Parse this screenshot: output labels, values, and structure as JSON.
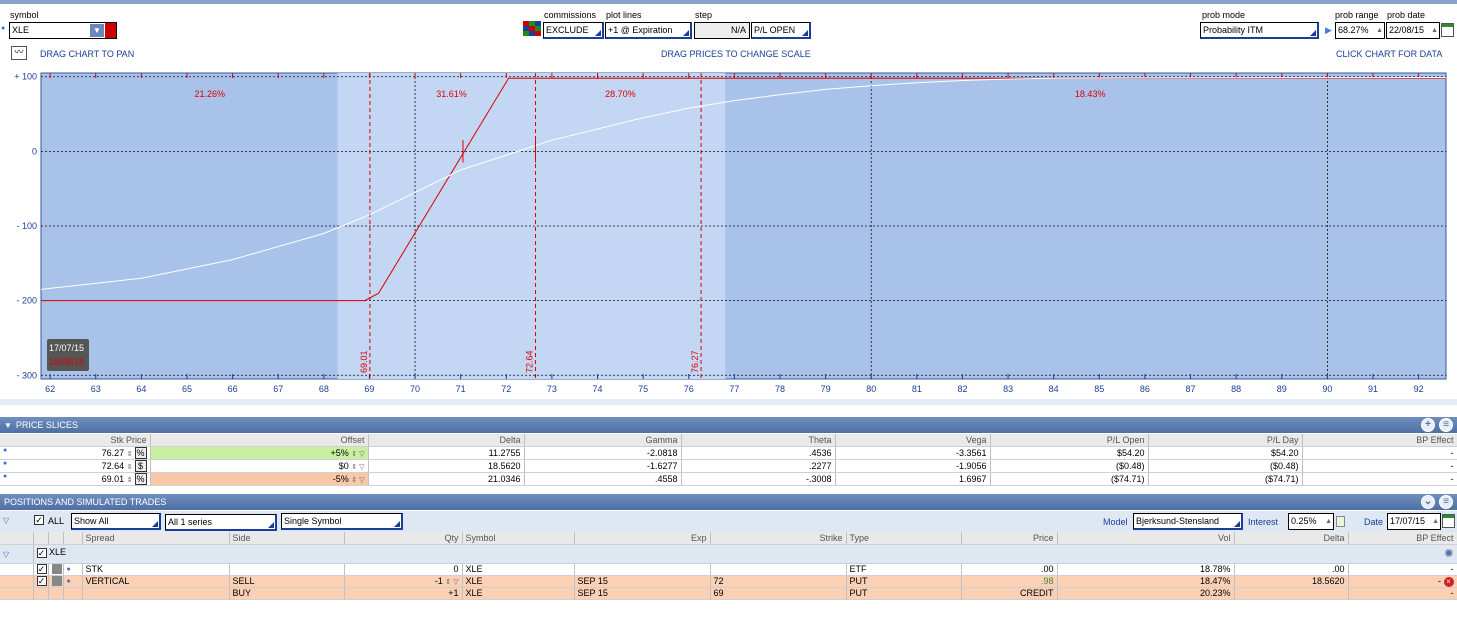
{
  "top": {
    "symbol_label": "symbol",
    "symbol_value": "XLE",
    "commissions_label": "commissions",
    "commissions_value": "EXCLUDE",
    "plot_lines_label": "plot lines",
    "plot_lines_value": "+1 @ Expiration",
    "step_label": "step",
    "step_value": "N/A",
    "pl_mode_value": "P/L OPEN",
    "prob_mode_label": "prob mode",
    "prob_mode_value": "Probability ITM",
    "prob_range_label": "prob range",
    "prob_range_value": "68.27%",
    "prob_date_label": "prob date",
    "prob_date_value": "22/08/15",
    "drag_pan": "DRAG CHART TO PAN",
    "drag_prices": "DRAG PRICES TO CHANGE SCALE",
    "click_chart": "CLICK CHART FOR DATA"
  },
  "chart_data": {
    "type": "line",
    "xlim": [
      61.8,
      92.6
    ],
    "ylim": [
      -305,
      105
    ],
    "x_ticks": [
      62,
      63,
      64,
      65,
      66,
      67,
      68,
      69,
      70,
      71,
      72,
      73,
      74,
      75,
      76,
      77,
      78,
      79,
      80,
      81,
      82,
      83,
      84,
      85,
      86,
      87,
      88,
      89,
      90,
      91,
      92
    ],
    "y_ticks": [
      100,
      0,
      -100,
      -200,
      -300
    ],
    "y_tick_labels": [
      "+ 100",
      "0",
      "- 100",
      "- 200",
      "- 300"
    ],
    "dashed_strikes": [
      69.01,
      72.64,
      76.27
    ],
    "strike_labels": [
      "69.01",
      "72.64",
      "76.27"
    ],
    "region_percents": [
      {
        "x": 65.5,
        "label": "21.26%"
      },
      {
        "x": 70.8,
        "label": "31.61%"
      },
      {
        "x": 74.5,
        "label": "28.70%"
      },
      {
        "x": 84.8,
        "label": "18.43%"
      }
    ],
    "light_band": [
      68.3,
      76.8
    ],
    "series": [
      {
        "name": "Expiration",
        "color": "#e00000",
        "points": [
          [
            61.8,
            -200
          ],
          [
            68.9,
            -200
          ],
          [
            69.2,
            -190
          ],
          [
            72.05,
            98
          ],
          [
            92.6,
            98
          ]
        ]
      },
      {
        "name": "Current",
        "color": "#ffffff",
        "points": [
          [
            61.8,
            -185
          ],
          [
            64,
            -170
          ],
          [
            66,
            -145
          ],
          [
            68,
            -110
          ],
          [
            69,
            -85
          ],
          [
            70,
            -55
          ],
          [
            71,
            -25
          ],
          [
            72,
            -5
          ],
          [
            73,
            15
          ],
          [
            74,
            30
          ],
          [
            75,
            45
          ],
          [
            76,
            58
          ],
          [
            77,
            68
          ],
          [
            78,
            76
          ],
          [
            79,
            83
          ],
          [
            80,
            88
          ],
          [
            81,
            92
          ],
          [
            82,
            95
          ],
          [
            83,
            97
          ],
          [
            84,
            98
          ],
          [
            86,
            98.5
          ],
          [
            92.6,
            98.8
          ]
        ]
      }
    ],
    "date_box": [
      "17/07/15",
      "18/08/15"
    ]
  },
  "price_slices": {
    "title": "PRICE SLICES",
    "headers": [
      "Stk Price",
      "Offset",
      "Delta",
      "Gamma",
      "Theta",
      "Vega",
      "P/L Open",
      "P/L Day",
      "BP Effect"
    ],
    "rows": [
      {
        "price": "76.27",
        "unit": "%",
        "offset": "+5%",
        "delta": "11.2755",
        "gamma": "-2.0818",
        "theta": ".4536",
        "vega": "-3.3561",
        "pl_open": "$54.20",
        "pl_day": "$54.20",
        "bp": "-"
      },
      {
        "price": "72.64",
        "unit": "$",
        "offset": "$0",
        "delta": "18.5620",
        "gamma": "-1.6277",
        "theta": ".2277",
        "vega": "-1.9056",
        "pl_open": "($0.48)",
        "pl_day": "($0.48)",
        "bp": "-"
      },
      {
        "price": "69.01",
        "unit": "%",
        "offset": "-5%",
        "delta": "21.0346",
        "gamma": ".4558",
        "theta": "-.3008",
        "vega": "1.6967",
        "pl_open": "($74.71)",
        "pl_day": "($74.71)",
        "bp": "-"
      }
    ],
    "offset_colors": [
      "#c8f0a0",
      "#ffffff",
      "#f9c8a8"
    ]
  },
  "positions": {
    "title": "POSITIONS AND SIMULATED TRADES",
    "all_label": "ALL",
    "show_all": "Show All",
    "series_value": "All 1 series",
    "symbol_mode": "Single Symbol",
    "model_label": "Model",
    "model_value": "Bjerksund-Stensland",
    "interest_label": "Interest",
    "interest_value": "0.25%",
    "date_label": "Date",
    "date_value": "17/07/15",
    "headers": [
      "Spread",
      "Side",
      "Qty",
      "Symbol",
      "Exp",
      "Strike",
      "Type",
      "Price",
      "Vol",
      "Delta",
      "BP Effect"
    ],
    "group_label": "XLE",
    "rows": [
      {
        "spread": "STK",
        "side": "",
        "qty": "0",
        "symbol": "XLE",
        "exp": "",
        "strike": "",
        "type": "ETF",
        "price": ".00",
        "vol": "18.78%",
        "delta": ".00",
        "bp": "-"
      },
      {
        "spread": "VERTICAL",
        "side": "SELL",
        "qty": "-1",
        "symbol": "XLE",
        "exp": "SEP 15",
        "strike": "72",
        "type": "PUT",
        "price": ".98",
        "vol": "18.47%",
        "delta": "18.5620",
        "bp": "-"
      },
      {
        "spread": "",
        "side": "BUY",
        "qty": "+1",
        "symbol": "XLE",
        "exp": "SEP 15",
        "strike": "69",
        "type": "PUT",
        "price": "CREDIT",
        "vol": "20.23%",
        "delta": "",
        "bp": "-"
      }
    ]
  }
}
